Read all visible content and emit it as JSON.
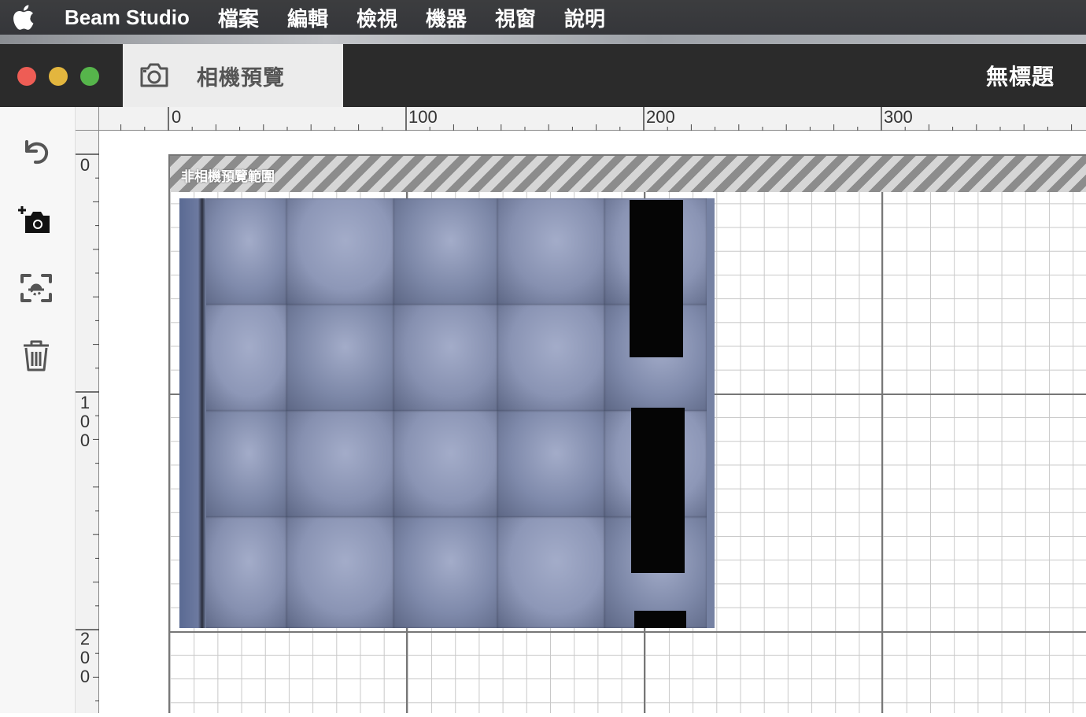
{
  "menubar": {
    "app_name": "Beam Studio",
    "items": [
      "檔案",
      "編輯",
      "檢視",
      "機器",
      "視窗",
      "說明"
    ]
  },
  "window": {
    "tab_label": "相機預覽",
    "document_title": "無標題"
  },
  "toolbar": {
    "tools": [
      "undo-icon",
      "add-camera-icon",
      "auto-focus-icon",
      "trash-icon"
    ]
  },
  "rulers": {
    "top_labels": [
      "0",
      "100",
      "200",
      "300"
    ],
    "left_labels": [
      "0",
      "100",
      "200"
    ]
  },
  "canvas": {
    "out_of_range_label": "非相機預覽範圍"
  },
  "colors": {
    "menubar": "#3c3d3f",
    "titlebar": "#2b2b2b",
    "close": "#ee5d55",
    "minimize": "#e3b63e",
    "maximize": "#56b54b"
  }
}
